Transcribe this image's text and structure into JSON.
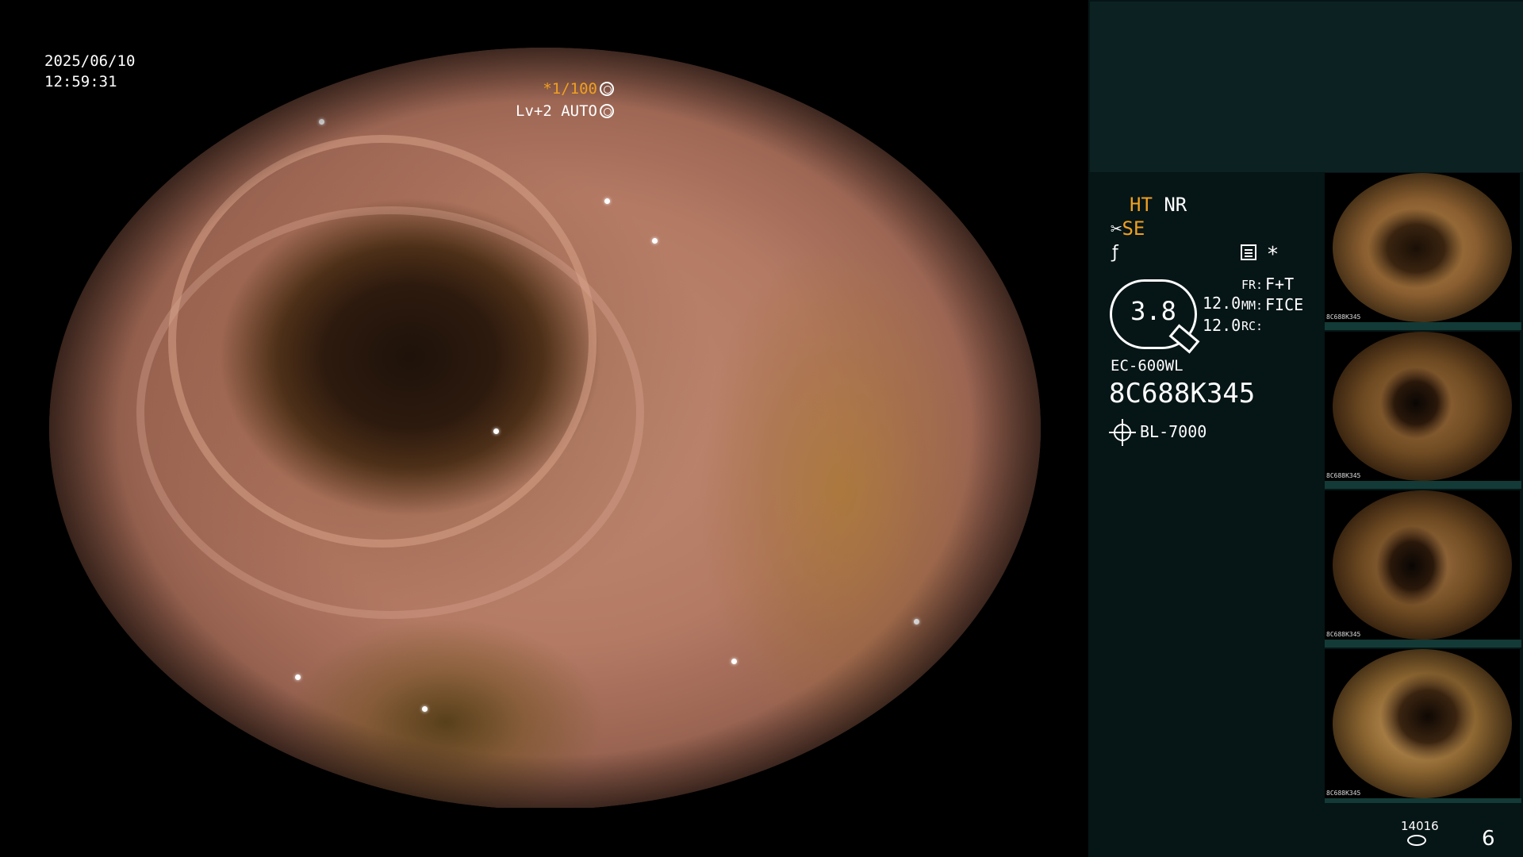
{
  "capture": {
    "date": "2025/06/10",
    "time": "12:59:31"
  },
  "exposure": {
    "shutter": "*1/100",
    "level": "Lv+2",
    "mode": "AUTO"
  },
  "enhancement": {
    "ht": "HT",
    "nr": "NR",
    "se": "SE",
    "colors": {
      "active": "#f0a020",
      "inactive": "#ffffff"
    }
  },
  "zoom": {
    "value": "3.8",
    "focal_a": "12.0",
    "focal_b": "12.0",
    "fr_label": "FR:",
    "fr_value": "F+T",
    "mm_label": "MM:",
    "mm_value": "FICE",
    "rc_label": "RC:"
  },
  "scope": {
    "model": "EC-600WL",
    "serial": "8C688K345"
  },
  "light_source": {
    "icon": "light-icon",
    "model": "BL-7000"
  },
  "footer": {
    "image_count": "14016",
    "page": "6"
  },
  "thumbnails": [
    {
      "serial": "8C688K345"
    },
    {
      "serial": "8C688K345"
    },
    {
      "serial": "8C688K345"
    },
    {
      "serial": "8C688K345"
    }
  ]
}
